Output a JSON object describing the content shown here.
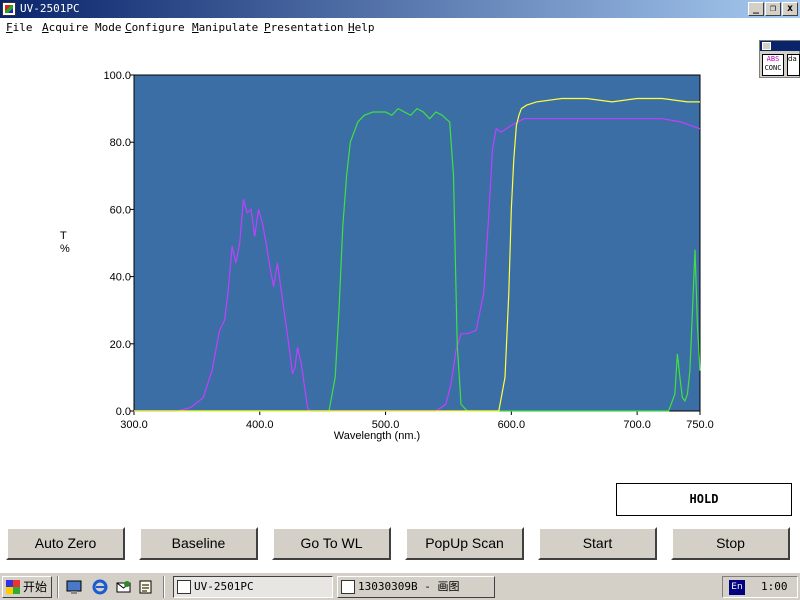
{
  "window": {
    "title": "UV-2501PC",
    "controls": {
      "minimize": "_",
      "restore": "❐",
      "close": "x"
    }
  },
  "menu": [
    "File",
    "Acquire Mode",
    "Configure",
    "Manipulate",
    "Presentation",
    "Help"
  ],
  "sidebox": {
    "icon1_top": "ABS",
    "icon1_bottom": "CONC",
    "icon2_text": "da"
  },
  "chart_data": {
    "type": "line",
    "xlabel": "Wavelength (nm.)",
    "ylabel": "T\n%",
    "xlim": [
      300,
      750
    ],
    "ylim": [
      0,
      100
    ],
    "xticks": [
      "300.0",
      "400.0",
      "500.0",
      "600.0",
      "700.0",
      "750.0"
    ],
    "xtick_values": [
      300,
      400,
      500,
      600,
      700,
      750
    ],
    "yticks": [
      "0.0",
      "20.0",
      "40.0",
      "60.0",
      "80.0",
      "100.0"
    ],
    "ytick_values": [
      0,
      20,
      40,
      60,
      80,
      100
    ],
    "background": "#3b6ea5",
    "series": [
      {
        "color": "#c040ff",
        "x": [
          300,
          335,
          345,
          355,
          362,
          368,
          372,
          375,
          378,
          381,
          384,
          387,
          390,
          393,
          396,
          399,
          402,
          405,
          408,
          411,
          414,
          417,
          420,
          423,
          426,
          428,
          430,
          433,
          436,
          438,
          440,
          445,
          540,
          548,
          552,
          556,
          560,
          565,
          572,
          578,
          582,
          585,
          588,
          592,
          600,
          610,
          620,
          640,
          660,
          680,
          700,
          720,
          735,
          750
        ],
        "y": [
          0,
          0,
          1,
          4,
          12,
          24,
          27,
          36,
          49,
          44,
          50,
          63,
          59,
          60,
          52,
          60,
          56,
          50,
          43,
          37,
          44,
          36,
          28,
          20,
          11,
          13,
          19,
          14,
          6,
          1,
          0,
          0,
          0,
          2,
          8,
          18,
          23,
          23,
          24,
          35,
          58,
          78,
          84,
          83,
          85,
          87,
          87,
          87,
          87,
          87,
          87,
          87,
          86,
          84
        ]
      },
      {
        "color": "#40e040",
        "x": [
          300,
          455,
          460,
          463,
          466,
          469,
          472,
          475,
          478,
          483,
          490,
          500,
          505,
          510,
          515,
          520,
          525,
          530,
          535,
          540,
          545,
          548,
          551,
          554,
          557,
          560,
          565,
          570,
          700,
          725,
          730,
          732,
          734,
          736,
          738,
          740,
          742,
          744,
          746,
          748,
          750
        ],
        "y": [
          0,
          0,
          10,
          30,
          55,
          70,
          80,
          83,
          86,
          88,
          89,
          89,
          88,
          90,
          89,
          88,
          90,
          89,
          87,
          89,
          88,
          87,
          86,
          70,
          20,
          2,
          0,
          0,
          0,
          0,
          5,
          17,
          10,
          4,
          3,
          5,
          12,
          30,
          48,
          25,
          12
        ]
      },
      {
        "color": "#ffff40",
        "x": [
          300,
          500,
          590,
          595,
          598,
          600,
          602,
          604,
          606,
          608,
          612,
          620,
          640,
          660,
          680,
          700,
          720,
          740,
          750
        ],
        "y": [
          0,
          0,
          0,
          10,
          35,
          60,
          75,
          85,
          88,
          90,
          91,
          92,
          93,
          93,
          92,
          93,
          93,
          92,
          92
        ]
      }
    ]
  },
  "status": {
    "hold": "HOLD"
  },
  "buttons": [
    "Auto Zero",
    "Baseline",
    "Go To WL",
    "PopUp Scan",
    "Start",
    "Stop"
  ],
  "taskbar": {
    "start": "开始",
    "tasks": [
      "UV-2501PC",
      "13030309B - 画图"
    ],
    "lang": "En",
    "clock": "1:00"
  }
}
